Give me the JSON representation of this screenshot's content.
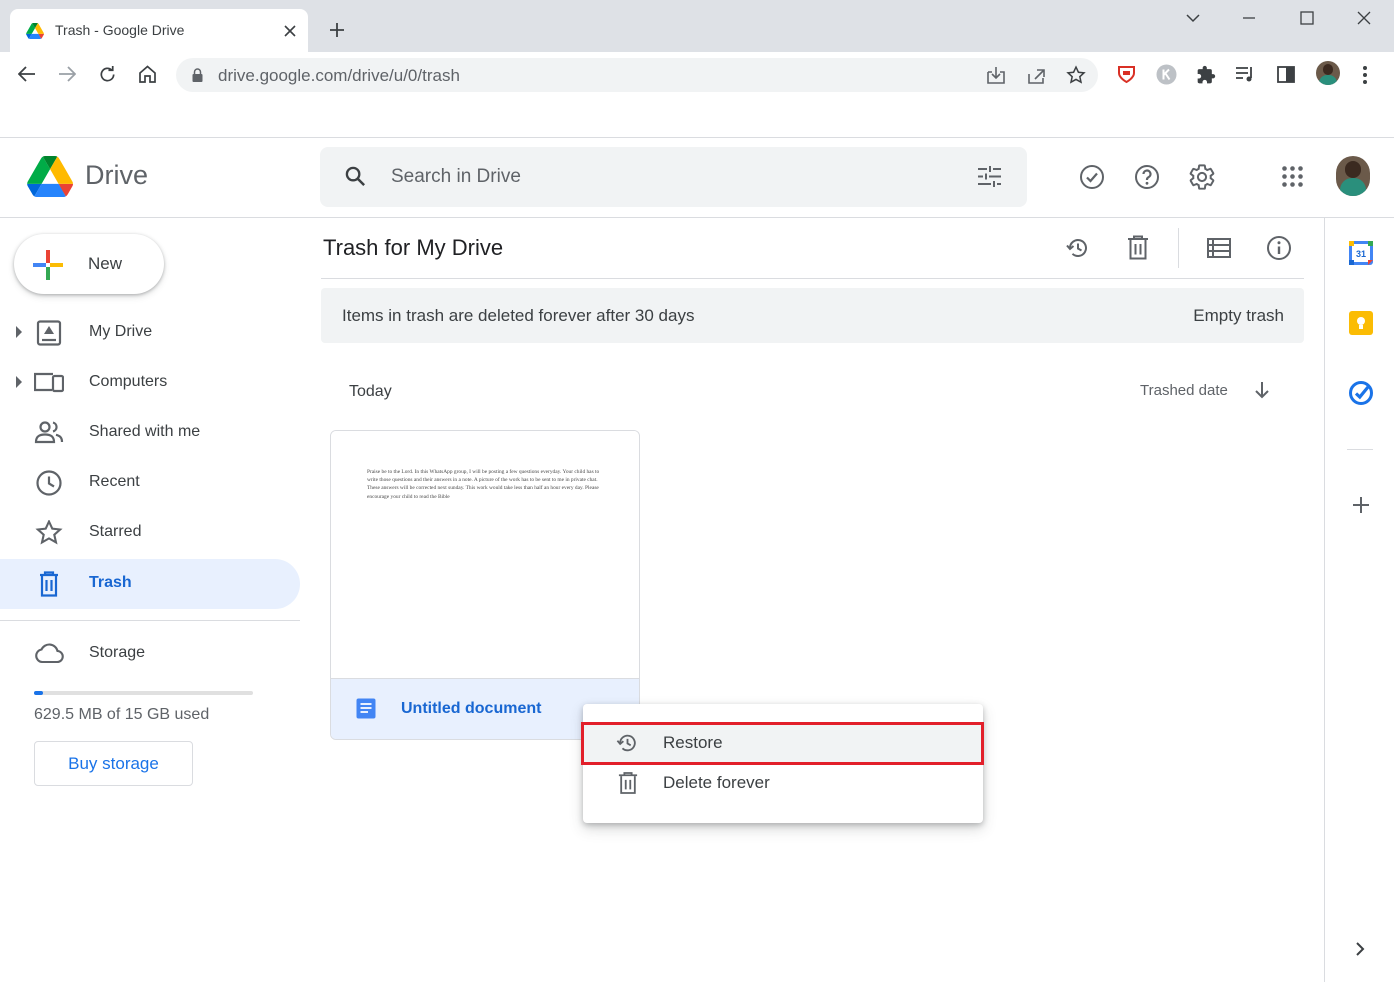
{
  "browser": {
    "tab_title": "Trash - Google Drive",
    "url": "drive.google.com/drive/u/0/trash"
  },
  "header": {
    "app_name": "Drive",
    "search_placeholder": "Search in Drive"
  },
  "sidebar": {
    "new_label": "New",
    "items": [
      {
        "label": "My Drive",
        "icon": "my-drive-icon"
      },
      {
        "label": "Computers",
        "icon": "computers-icon"
      },
      {
        "label": "Shared with me",
        "icon": "shared-icon"
      },
      {
        "label": "Recent",
        "icon": "clock-icon"
      },
      {
        "label": "Starred",
        "icon": "star-icon"
      },
      {
        "label": "Trash",
        "icon": "trash-icon"
      }
    ],
    "storage_label": "Storage",
    "storage_used_text": "629.5 MB of 15 GB used",
    "storage_used_fraction": 0.04,
    "buy_storage_label": "Buy storage"
  },
  "main": {
    "title": "Trash for My Drive",
    "banner_text": "Items in trash are deleted forever after 30 days",
    "empty_trash_label": "Empty trash",
    "section_label": "Today",
    "sort_label": "Trashed date",
    "file": {
      "name": "Untitled document",
      "preview_text": "Praise be to the Lord. In this WhatsApp group, I will be posting a few questions everyday. Your child has to write those questions and their answers in a note. A picture of the work has to be sent to me in private chat. These answers will be corrected next sunday. This work would take less than half an hour every day. Please encourage your child to read the Bible"
    }
  },
  "context_menu": {
    "restore_label": "Restore",
    "delete_label": "Delete forever"
  },
  "colors": {
    "accent_blue": "#1a73e8",
    "active_nav_bg": "#e8f0fe",
    "highlight_red": "#e21f2a"
  }
}
